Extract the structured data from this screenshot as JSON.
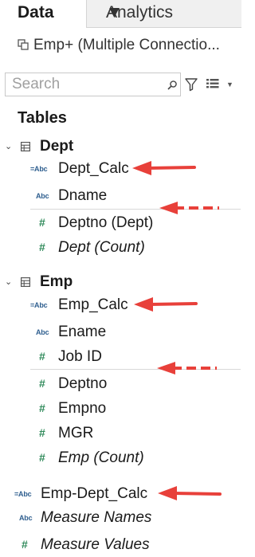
{
  "tabs": {
    "data": "Data",
    "analytics": "Analytics"
  },
  "connection": {
    "label": "Emp+ (Multiple Connectio..."
  },
  "search": {
    "placeholder": "Search"
  },
  "tables_heading": "Tables",
  "groups": [
    {
      "name": "Dept",
      "fields": [
        {
          "type": "calc-string",
          "label": "Dept_Calc",
          "italic": false
        },
        {
          "type": "string",
          "label": "Dname",
          "italic": false
        },
        {
          "type": "number",
          "label": "Deptno (Dept)",
          "italic": false
        },
        {
          "type": "number",
          "label": "Dept (Count)",
          "italic": true
        }
      ]
    },
    {
      "name": "Emp",
      "fields": [
        {
          "type": "calc-string",
          "label": "Emp_Calc",
          "italic": false
        },
        {
          "type": "string",
          "label": "Ename",
          "italic": false
        },
        {
          "type": "number",
          "label": "Job ID",
          "italic": false
        },
        {
          "type": "number",
          "label": "Deptno",
          "italic": false
        },
        {
          "type": "number",
          "label": "Empno",
          "italic": false
        },
        {
          "type": "number",
          "label": "MGR",
          "italic": false
        },
        {
          "type": "number",
          "label": "Emp (Count)",
          "italic": true
        }
      ]
    }
  ],
  "loose_fields": [
    {
      "type": "calc-string",
      "label": "Emp-Dept_Calc",
      "italic": false
    },
    {
      "type": "string",
      "label": "Measure Names",
      "italic": true
    },
    {
      "type": "number",
      "label": "Measure Values",
      "italic": true
    }
  ],
  "glyphs": {
    "string": "Abc",
    "calc-string": "=Abc",
    "number": "#"
  },
  "colors": {
    "arrow": "#e8403a",
    "string_icon": "#2f5f8f",
    "number_icon": "#2f8a5a"
  }
}
